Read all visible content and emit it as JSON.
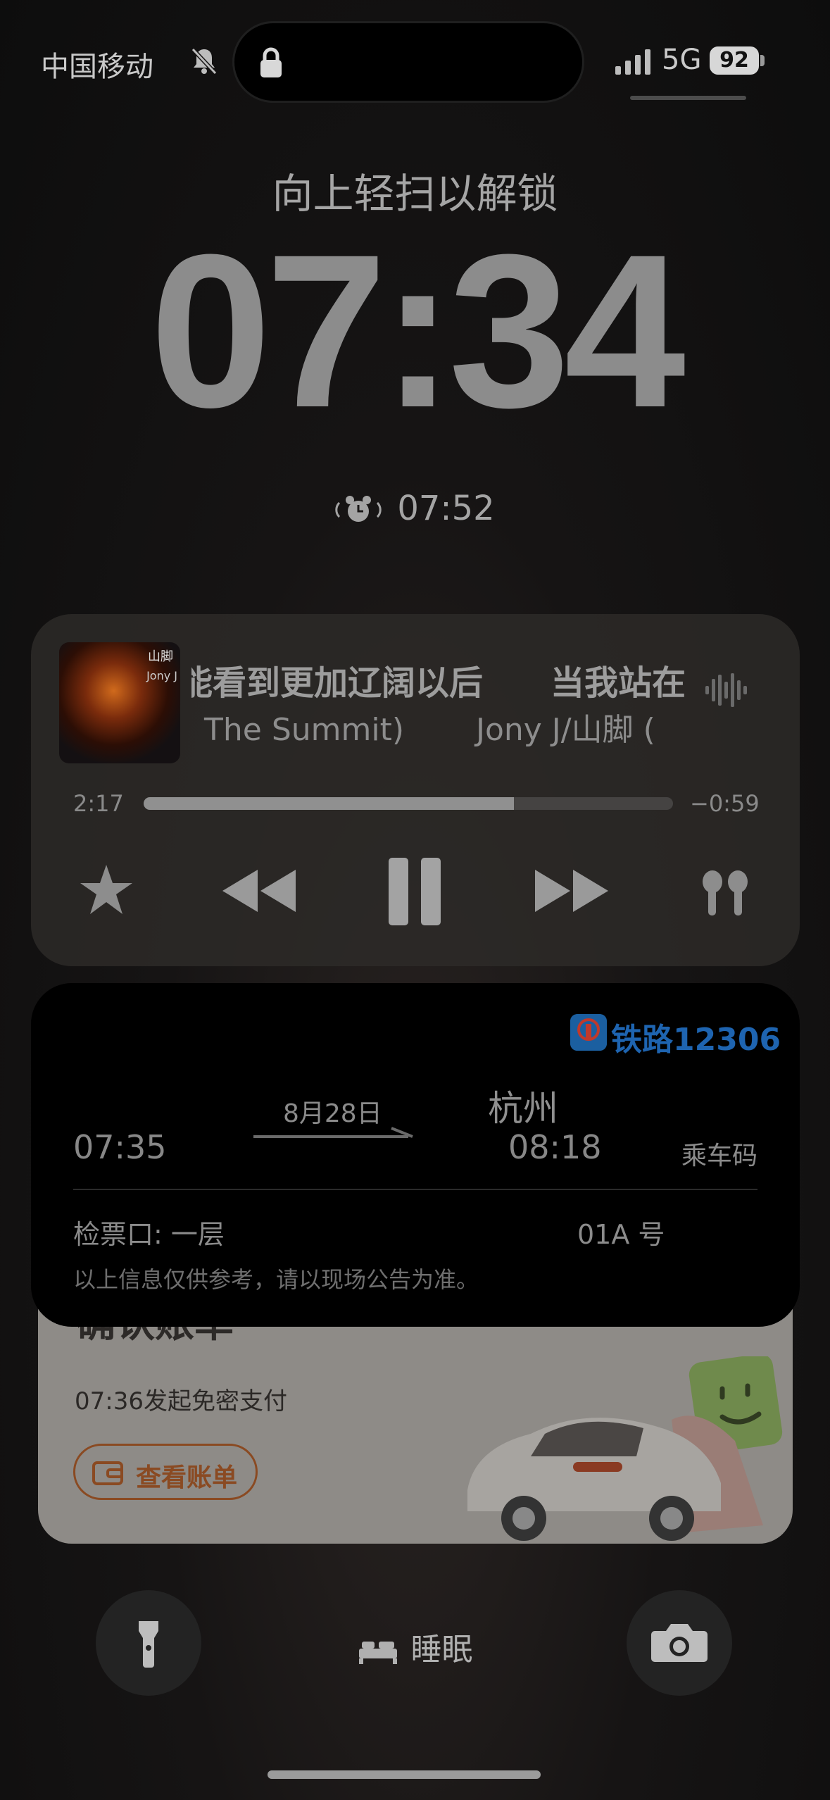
{
  "status_bar": {
    "carrier": "中国移动",
    "network": "5G",
    "battery": "92",
    "icons": [
      "silent-bell-icon",
      "lock-icon",
      "signal-icon"
    ]
  },
  "lock_screen": {
    "unlock_hint": "向上轻扫以解锁",
    "time": "07:34",
    "alarm": "07:52",
    "alarm_icon": "alarm-clock-icon"
  },
  "music": {
    "lyric_line1": "能看到更加辽阔以后　　当我站在",
    "lyric_line2": "The Summit)　　 Jony J/山脚 (",
    "cover_text1": "山脚",
    "cover_text2": "Jony J",
    "elapsed": "2:17",
    "remaining": "−0:59",
    "progress": 0.7,
    "controls": [
      "star-icon",
      "rewind-icon",
      "pause-icon",
      "fast-forward-icon",
      "airpods-icon"
    ]
  },
  "train": {
    "brand": "铁路12306",
    "date": "8月28日",
    "destination": "杭州",
    "depart_time": "07:35",
    "arrive_time": "08:18",
    "ride_code": "乘车码",
    "gate": "检票口: 一层",
    "seat": "01A 号",
    "note": "以上信息仅供参考，请以现场公告为准。",
    "brand_color": "#1e64b0"
  },
  "bill": {
    "title": "确认账单",
    "subtitle": "07:36发起免密支付",
    "button": "查看账单",
    "accent": "#8a4a22"
  },
  "bottom": {
    "sleep": "睡眠",
    "icons": [
      "flashlight-icon",
      "bed-icon",
      "camera-icon"
    ]
  }
}
